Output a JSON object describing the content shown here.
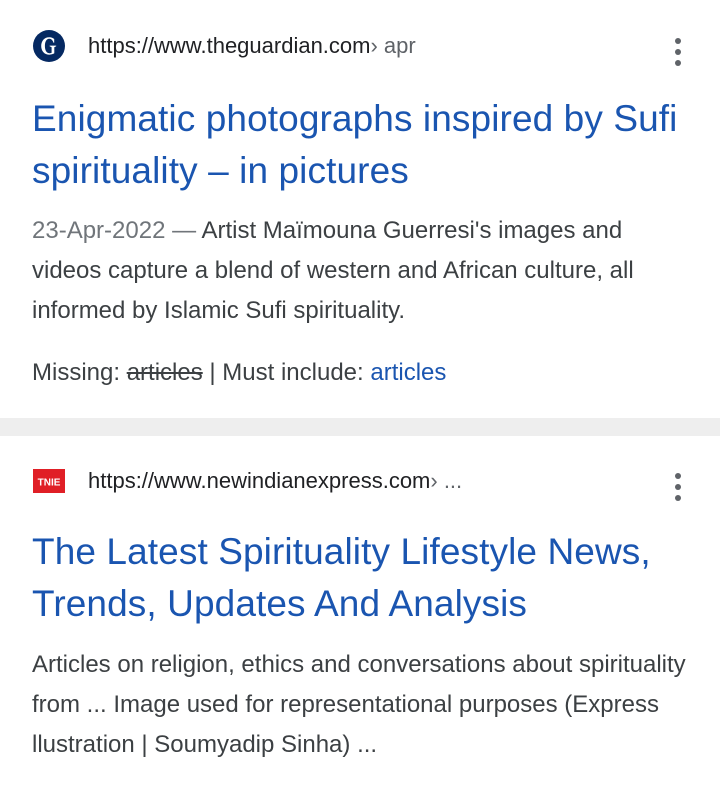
{
  "results": [
    {
      "favicon_icon": "guardian-g-icon",
      "url": "https://www.theguardian.com",
      "breadcrumb": " › apr",
      "title": "Enigmatic photographs inspired by Sufi spirituality – in pictures",
      "date": "23-Apr-2022",
      "date_separator": " — ",
      "snippet": "Artist Maïmouna Guerresi's images and videos capture a blend of western and African culture, all informed by Islamic Sufi spirituality.",
      "missing_label": "Missing: ",
      "missing_term": "articles",
      "must_include_label": " | Must include: ",
      "must_include_term": "articles",
      "menu_icon": "more-vert-icon"
    },
    {
      "favicon_icon": "tnie-logo-icon",
      "favicon_text": "TNIE",
      "url": "https://www.newindianexpress.com",
      "breadcrumb": " › ...",
      "title": "The Latest Spirituality Lifestyle News, Trends, Updates And Analysis",
      "snippet": "Articles on religion, ethics and conversations about spirituality from ... Image used for representational purposes (Express llustration | Soumyadip Sinha) ...",
      "menu_icon": "more-vert-icon"
    }
  ],
  "colors": {
    "link_blue": "#1a55b0",
    "text_dark": "#202124",
    "text_body": "#3c4043",
    "text_muted": "#70757a",
    "divider": "#eeeeee",
    "guardian_navy": "#052962",
    "tnie_red": "#e01f26"
  }
}
